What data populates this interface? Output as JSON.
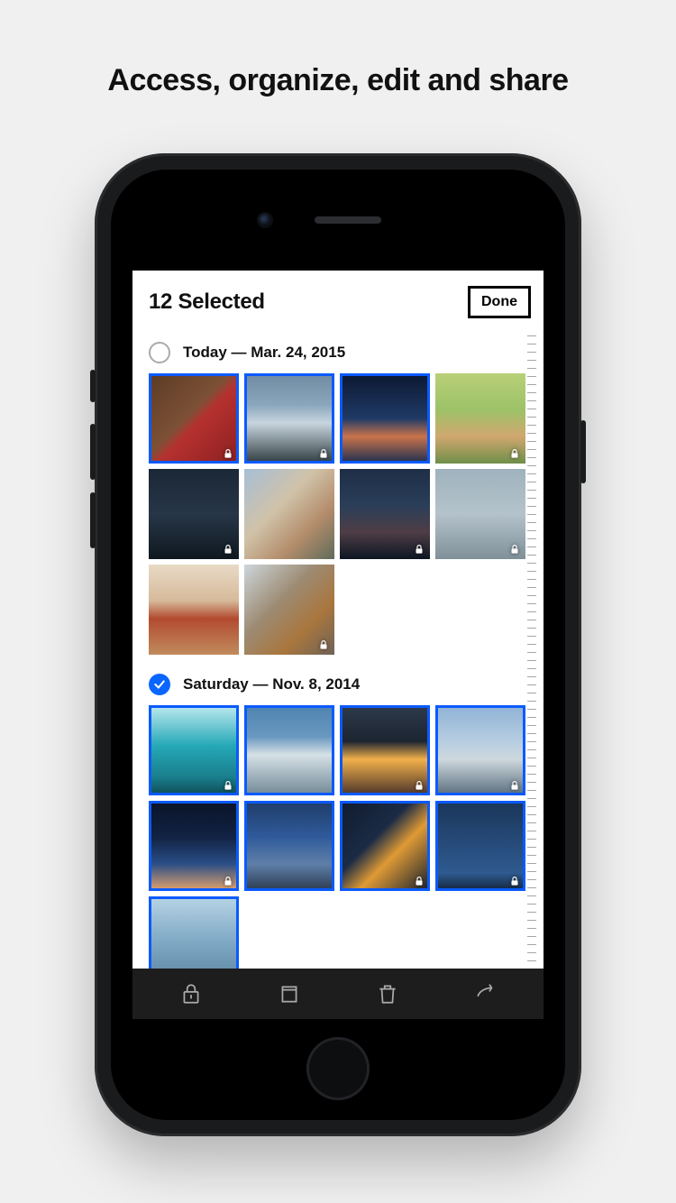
{
  "promo": {
    "title": "Access, organize, edit and share"
  },
  "header": {
    "selected_count_label": "12 Selected",
    "done_label": "Done"
  },
  "sections": [
    {
      "label": "Today — Mar. 24, 2015",
      "all_selected": false
    },
    {
      "label": "Saturday — Nov. 8, 2014",
      "all_selected": true
    }
  ],
  "photos_section0": [
    {
      "selected": true,
      "locked": true
    },
    {
      "selected": true,
      "locked": true
    },
    {
      "selected": true,
      "locked": false
    },
    {
      "selected": false,
      "locked": true
    },
    {
      "selected": false,
      "locked": true
    },
    {
      "selected": false,
      "locked": false
    },
    {
      "selected": false,
      "locked": true
    },
    {
      "selected": false,
      "locked": true
    },
    {
      "selected": false,
      "locked": false
    },
    {
      "selected": false,
      "locked": true
    }
  ],
  "photos_section1": [
    {
      "selected": true,
      "locked": true
    },
    {
      "selected": true,
      "locked": false
    },
    {
      "selected": true,
      "locked": true
    },
    {
      "selected": true,
      "locked": true
    },
    {
      "selected": true,
      "locked": true
    },
    {
      "selected": true,
      "locked": false
    },
    {
      "selected": true,
      "locked": true
    },
    {
      "selected": true,
      "locked": true
    },
    {
      "selected": true,
      "locked": false
    }
  ],
  "toolbar": {
    "lock": "lock-icon",
    "album": "album-icon",
    "delete": "trash-icon",
    "share": "share-icon"
  },
  "colors": {
    "accent": "#0a5aff",
    "check_bg": "#0a66ff"
  }
}
